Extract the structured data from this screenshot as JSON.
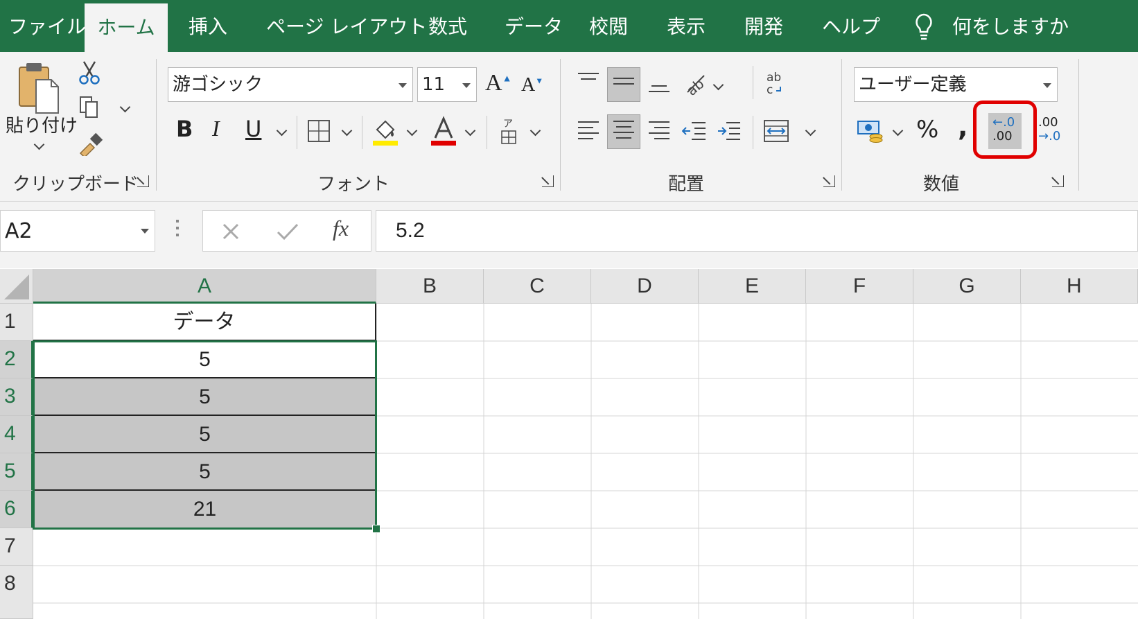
{
  "tabs": [
    {
      "label": "ファイル",
      "active": false
    },
    {
      "label": "ホーム",
      "active": true
    },
    {
      "label": "挿入",
      "active": false
    },
    {
      "label": "ページ レイアウト",
      "active": false
    },
    {
      "label": "数式",
      "active": false
    },
    {
      "label": "データ",
      "active": false
    },
    {
      "label": "校閲",
      "active": false
    },
    {
      "label": "表示",
      "active": false
    },
    {
      "label": "開発",
      "active": false
    },
    {
      "label": "ヘルプ",
      "active": false
    }
  ],
  "tell_me": "何をしますか",
  "clipboard": {
    "paste_label": "貼り付け",
    "group_label": "クリップボード"
  },
  "font": {
    "name": "游ゴシック",
    "size": "11",
    "group_label": "フォント",
    "bold": "B",
    "italic": "I",
    "underline": "U",
    "grow": "A",
    "shrink": "A"
  },
  "alignment": {
    "group_label": "配置"
  },
  "number": {
    "format": "ユーザー定義",
    "group_label": "数値",
    "percent": "%",
    "comma": ",",
    "increase_decimal": ".00",
    "decrease_decimal": ".0"
  },
  "formula_bar": {
    "name_box": "A2",
    "fx": "fx",
    "value": "5.2"
  },
  "columns": [
    "A",
    "B",
    "C",
    "D",
    "E",
    "F",
    "G",
    "H"
  ],
  "rows": [
    "1",
    "2",
    "3",
    "4",
    "5",
    "6",
    "7",
    "8"
  ],
  "cells": [
    "データ",
    "5",
    "5",
    "5",
    "5",
    "21"
  ],
  "colors": {
    "accent": "#217346",
    "highlight": "#e00000",
    "fill_yellow": "#ffeb00",
    "font_red": "#e00000",
    "selection": "#c6c6c6"
  }
}
